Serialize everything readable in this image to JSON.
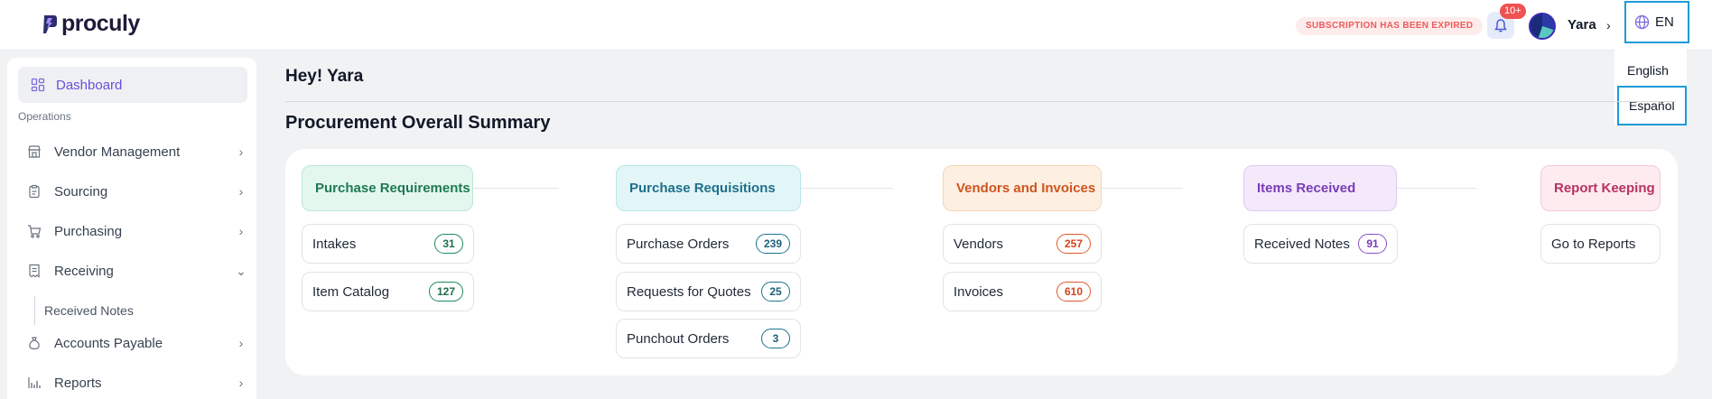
{
  "header": {
    "brand": "proculy",
    "subscription_notice": "SUBSCRIPTION HAS BEEN EXPIRED",
    "notifications_count": "10+",
    "user_name": "Yara",
    "language_code": "EN"
  },
  "language_menu": {
    "options": [
      "English",
      "Español"
    ],
    "highlighted": "Español"
  },
  "sidebar": {
    "dashboard_label": "Dashboard",
    "section_label": "Operations",
    "items": [
      {
        "label": "Vendor Management",
        "icon": "store-icon",
        "chevron": "›"
      },
      {
        "label": "Sourcing",
        "icon": "clipboard-icon",
        "chevron": "›"
      },
      {
        "label": "Purchasing",
        "icon": "cart-icon",
        "chevron": "›"
      },
      {
        "label": "Receiving",
        "icon": "receipt-icon",
        "chevron": "⌄"
      },
      {
        "label": "Accounts Payable",
        "icon": "moneybag-icon",
        "chevron": "›"
      },
      {
        "label": "Reports",
        "icon": "bar-chart-icon",
        "chevron": "›"
      }
    ],
    "receiving_sub_items": [
      "Received Notes"
    ]
  },
  "main": {
    "greeting": "Hey! Yara",
    "summary_title": "Procurement Overall Summary",
    "colors": {
      "green": "#1d8a5a",
      "teal": "#1e7390",
      "orange": "#e0572b",
      "purple": "#8b4fc7",
      "pink": "#b8325e"
    },
    "categories": [
      {
        "title": "Purchase Requirements",
        "items": [
          {
            "label": "Intakes",
            "count": "31"
          },
          {
            "label": "Item Catalog",
            "count": "127"
          }
        ]
      },
      {
        "title": "Purchase Requisitions",
        "items": [
          {
            "label": "Purchase Orders",
            "count": "239"
          },
          {
            "label": "Requests for Quotes",
            "count": "25"
          },
          {
            "label": "Punchout Orders",
            "count": "3"
          }
        ]
      },
      {
        "title": "Vendors and Invoices",
        "items": [
          {
            "label": "Vendors",
            "count": "257"
          },
          {
            "label": "Invoices",
            "count": "610"
          }
        ]
      },
      {
        "title": "Items Received",
        "items": [
          {
            "label": "Received Notes",
            "count": "91"
          }
        ]
      },
      {
        "title": "Report Keeping",
        "items": [
          {
            "label": "Go to Reports"
          }
        ]
      }
    ]
  }
}
